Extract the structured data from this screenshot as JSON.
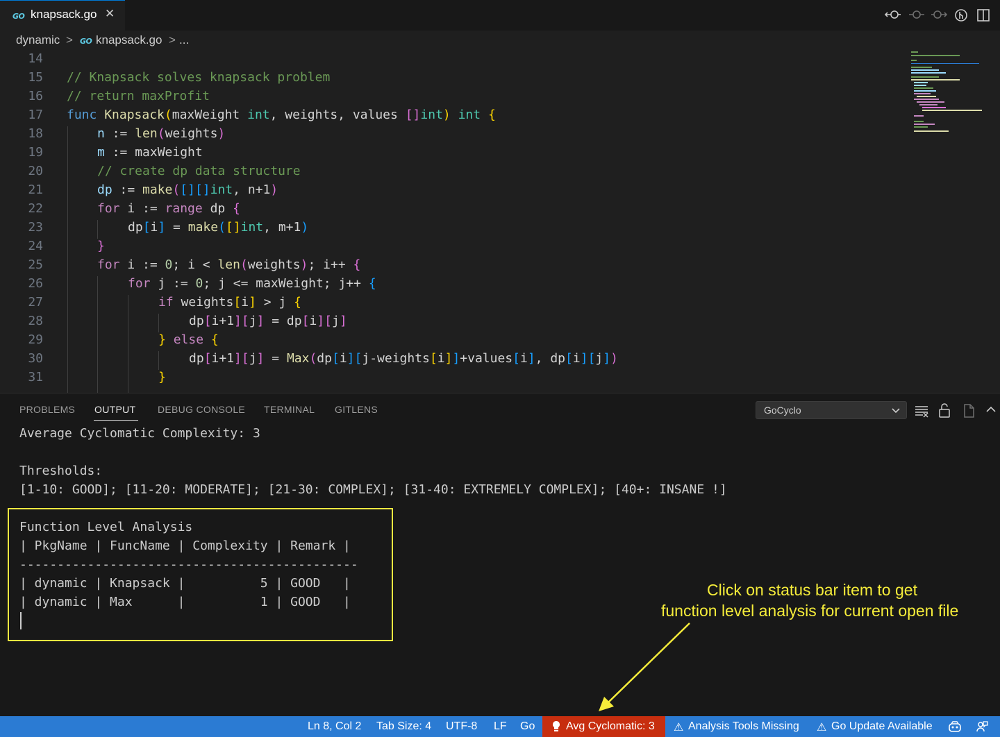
{
  "tab": {
    "title": "knapsack.go",
    "close": "✕",
    "go_logo": "GO"
  },
  "breadcrumb": {
    "folder": "dynamic",
    "sep": ">",
    "file": "knapsack.go",
    "sep2": ">",
    "more": "..."
  },
  "editor": {
    "lines": [
      {
        "n": "14",
        "indent": 0,
        "tokens": []
      },
      {
        "n": "15",
        "indent": 0,
        "tokens": [
          {
            "t": "// Knapsack solves knapsack problem",
            "c": "cm"
          }
        ]
      },
      {
        "n": "16",
        "indent": 0,
        "tokens": [
          {
            "t": "// return maxProfit",
            "c": "cm"
          }
        ]
      },
      {
        "n": "17",
        "indent": 0,
        "tokens": [
          {
            "t": "func ",
            "c": "kb"
          },
          {
            "t": "Knapsack",
            "c": "fn"
          },
          {
            "t": "(",
            "c": "b1"
          },
          {
            "t": "maxWeight ",
            "c": ""
          },
          {
            "t": "int",
            "c": "t"
          },
          {
            "t": ", weights, values ",
            "c": ""
          },
          {
            "t": "[]",
            "c": "b2"
          },
          {
            "t": "int",
            "c": "t"
          },
          {
            "t": ")",
            "c": "b1"
          },
          {
            "t": " ",
            "c": ""
          },
          {
            "t": "int",
            "c": "t"
          },
          {
            "t": " ",
            "c": ""
          },
          {
            "t": "{",
            "c": "b1"
          }
        ]
      },
      {
        "n": "18",
        "indent": 1,
        "tokens": [
          {
            "t": "n",
            "c": "v"
          },
          {
            "t": " := ",
            "c": ""
          },
          {
            "t": "len",
            "c": "fn"
          },
          {
            "t": "(",
            "c": "b2"
          },
          {
            "t": "weights",
            "c": ""
          },
          {
            "t": ")",
            "c": "b2"
          }
        ]
      },
      {
        "n": "19",
        "indent": 1,
        "tokens": [
          {
            "t": "m",
            "c": "v"
          },
          {
            "t": " := maxWeight",
            "c": ""
          }
        ]
      },
      {
        "n": "20",
        "indent": 1,
        "tokens": [
          {
            "t": "// create dp data structure",
            "c": "cm"
          }
        ]
      },
      {
        "n": "21",
        "indent": 1,
        "tokens": [
          {
            "t": "dp",
            "c": "v"
          },
          {
            "t": " := ",
            "c": ""
          },
          {
            "t": "make",
            "c": "fn"
          },
          {
            "t": "(",
            "c": "b2"
          },
          {
            "t": "[]",
            "c": "b3"
          },
          {
            "t": "[]",
            "c": "b3"
          },
          {
            "t": "int",
            "c": "t"
          },
          {
            "t": ", n+1",
            "c": ""
          },
          {
            "t": ")",
            "c": "b2"
          }
        ]
      },
      {
        "n": "22",
        "indent": 1,
        "tokens": [
          {
            "t": "for",
            "c": "k"
          },
          {
            "t": " i := ",
            "c": ""
          },
          {
            "t": "range",
            "c": "k"
          },
          {
            "t": " dp ",
            "c": ""
          },
          {
            "t": "{",
            "c": "b2"
          }
        ]
      },
      {
        "n": "23",
        "indent": 2,
        "tokens": [
          {
            "t": "dp",
            "c": ""
          },
          {
            "t": "[",
            "c": "b3"
          },
          {
            "t": "i",
            "c": ""
          },
          {
            "t": "]",
            "c": "b3"
          },
          {
            "t": " = ",
            "c": ""
          },
          {
            "t": "make",
            "c": "fn"
          },
          {
            "t": "(",
            "c": "b3"
          },
          {
            "t": "[]",
            "c": "b1"
          },
          {
            "t": "int",
            "c": "t"
          },
          {
            "t": ", m+1",
            "c": ""
          },
          {
            "t": ")",
            "c": "b3"
          }
        ]
      },
      {
        "n": "24",
        "indent": 1,
        "tokens": [
          {
            "t": "}",
            "c": "b2"
          }
        ]
      },
      {
        "n": "25",
        "indent": 1,
        "tokens": [
          {
            "t": "for",
            "c": "k"
          },
          {
            "t": " i := ",
            "c": ""
          },
          {
            "t": "0",
            "c": "num"
          },
          {
            "t": "; i < ",
            "c": ""
          },
          {
            "t": "len",
            "c": "fn"
          },
          {
            "t": "(",
            "c": "b2"
          },
          {
            "t": "weights",
            "c": ""
          },
          {
            "t": ")",
            "c": "b2"
          },
          {
            "t": "; i++ ",
            "c": ""
          },
          {
            "t": "{",
            "c": "b2"
          }
        ]
      },
      {
        "n": "26",
        "indent": 2,
        "tokens": [
          {
            "t": "for",
            "c": "k"
          },
          {
            "t": " j := ",
            "c": ""
          },
          {
            "t": "0",
            "c": "num"
          },
          {
            "t": "; j <= maxWeight; j++ ",
            "c": ""
          },
          {
            "t": "{",
            "c": "b3"
          }
        ]
      },
      {
        "n": "27",
        "indent": 3,
        "tokens": [
          {
            "t": "if",
            "c": "k"
          },
          {
            "t": " weights",
            "c": ""
          },
          {
            "t": "[",
            "c": "b1"
          },
          {
            "t": "i",
            "c": ""
          },
          {
            "t": "]",
            "c": "b1"
          },
          {
            "t": " > j ",
            "c": ""
          },
          {
            "t": "{",
            "c": "b1"
          }
        ]
      },
      {
        "n": "28",
        "indent": 4,
        "tokens": [
          {
            "t": "dp",
            "c": ""
          },
          {
            "t": "[",
            "c": "b2"
          },
          {
            "t": "i+1",
            "c": ""
          },
          {
            "t": "]",
            "c": "b2"
          },
          {
            "t": "[",
            "c": "b2"
          },
          {
            "t": "j",
            "c": ""
          },
          {
            "t": "]",
            "c": "b2"
          },
          {
            "t": " = dp",
            "c": ""
          },
          {
            "t": "[",
            "c": "b2"
          },
          {
            "t": "i",
            "c": ""
          },
          {
            "t": "]",
            "c": "b2"
          },
          {
            "t": "[",
            "c": "b2"
          },
          {
            "t": "j",
            "c": ""
          },
          {
            "t": "]",
            "c": "b2"
          }
        ]
      },
      {
        "n": "29",
        "indent": 3,
        "tokens": [
          {
            "t": "}",
            "c": "b1"
          },
          {
            "t": " ",
            "c": ""
          },
          {
            "t": "else",
            "c": "k"
          },
          {
            "t": " ",
            "c": ""
          },
          {
            "t": "{",
            "c": "b1"
          }
        ]
      },
      {
        "n": "30",
        "indent": 4,
        "tokens": [
          {
            "t": "dp",
            "c": ""
          },
          {
            "t": "[",
            "c": "b2"
          },
          {
            "t": "i+1",
            "c": ""
          },
          {
            "t": "]",
            "c": "b2"
          },
          {
            "t": "[",
            "c": "b2"
          },
          {
            "t": "j",
            "c": ""
          },
          {
            "t": "]",
            "c": "b2"
          },
          {
            "t": " = ",
            "c": ""
          },
          {
            "t": "Max",
            "c": "fn"
          },
          {
            "t": "(",
            "c": "b2"
          },
          {
            "t": "dp",
            "c": ""
          },
          {
            "t": "[",
            "c": "b3"
          },
          {
            "t": "i",
            "c": ""
          },
          {
            "t": "]",
            "c": "b3"
          },
          {
            "t": "[",
            "c": "b3"
          },
          {
            "t": "j-weights",
            "c": ""
          },
          {
            "t": "[",
            "c": "b1"
          },
          {
            "t": "i",
            "c": ""
          },
          {
            "t": "]",
            "c": "b1"
          },
          {
            "t": "]",
            "c": "b3"
          },
          {
            "t": "+values",
            "c": ""
          },
          {
            "t": "[",
            "c": "b3"
          },
          {
            "t": "i",
            "c": ""
          },
          {
            "t": "]",
            "c": "b3"
          },
          {
            "t": ", dp",
            "c": ""
          },
          {
            "t": "[",
            "c": "b3"
          },
          {
            "t": "i",
            "c": ""
          },
          {
            "t": "]",
            "c": "b3"
          },
          {
            "t": "[",
            "c": "b3"
          },
          {
            "t": "j",
            "c": ""
          },
          {
            "t": "]",
            "c": "b3"
          },
          {
            "t": ")",
            "c": "b2"
          }
        ]
      },
      {
        "n": "31",
        "indent": 3,
        "tokens": [
          {
            "t": "}",
            "c": "b1"
          }
        ]
      }
    ]
  },
  "panel": {
    "tabs": [
      {
        "label": "PROBLEMS",
        "active": false
      },
      {
        "label": "OUTPUT",
        "active": true
      },
      {
        "label": "DEBUG CONSOLE",
        "active": false
      },
      {
        "label": "TERMINAL",
        "active": false
      },
      {
        "label": "GITLENS",
        "active": false
      }
    ],
    "channel": "GoCyclo",
    "output": {
      "avg": "Average Cyclomatic Complexity: 3",
      "thresholds_title": "Thresholds:",
      "thresholds": "[1-10: GOOD]; [11-20: MODERATE]; [21-30: COMPLEX]; [31-40: EXTREMELY COMPLEX]; [40+: INSANE !]",
      "fla_title": "Function Level Analysis",
      "table_header": "| PkgName | FuncName | Complexity | Remark |",
      "table_sep": "---------------------------------------------",
      "rows": [
        "| dynamic | Knapsack |          5 | GOOD   |",
        "| dynamic | Max      |          1 | GOOD   |"
      ]
    }
  },
  "annotation": {
    "line1": "Click on status bar item to get",
    "line2": "function level analysis for current open file",
    "color": "#f5ec3a"
  },
  "statusbar": {
    "position": "Ln 8, Col 2",
    "tab_size": "Tab Size: 4",
    "encoding": "UTF-8",
    "eol": "LF",
    "language": "Go",
    "avg_cyclomatic": "Avg Cyclomatic: 3",
    "analysis_missing": "Analysis Tools Missing",
    "go_update": "Go Update Available",
    "warning_glyph": "⚠",
    "bg": "#2b7bd3",
    "alert_bg": "#c72e0f"
  }
}
